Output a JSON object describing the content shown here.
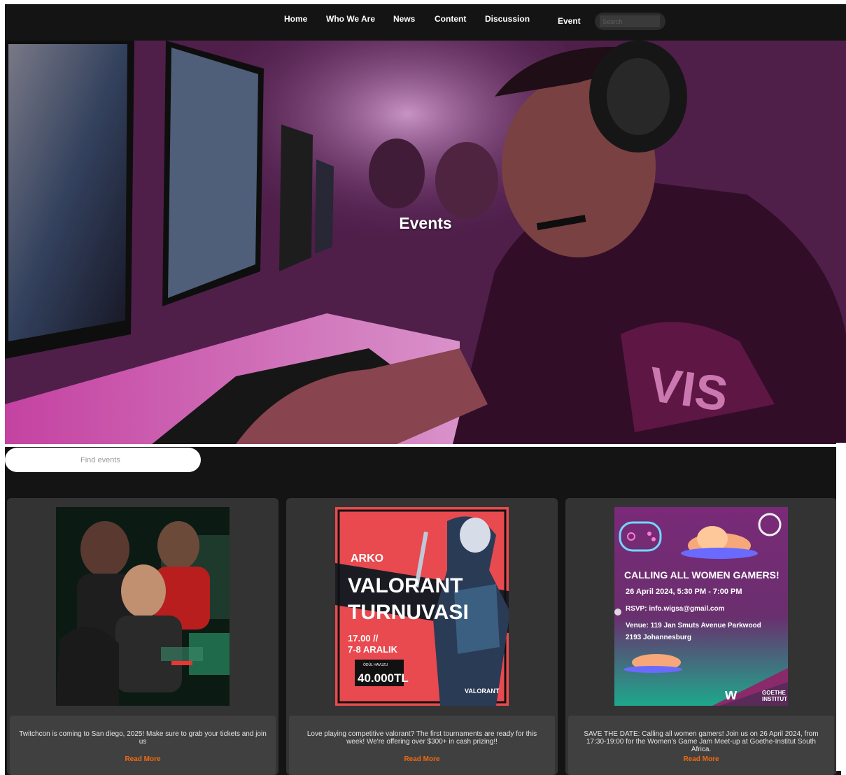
{
  "nav": {
    "items": [
      "Home",
      "Who We Are",
      "News",
      "Content",
      "Discussion",
      "Event"
    ],
    "search_placeholder": "Search"
  },
  "hero": {
    "title": "Events"
  },
  "events": {
    "find_placeholder": "Find events",
    "cards": [
      {
        "description": "Twitchcon is coming to San diego, 2025! Make sure to grab your tickets and join us",
        "link": "Read More"
      },
      {
        "description": "Love playing competitive valorant? The first tournaments are ready for this week! We're offering over $300+ in cash prizing!!",
        "link": "Read More",
        "poster": {
          "brand": "ARKO",
          "title_line1": "VALORANT",
          "title_line2": "TURNUVASI",
          "time": "17.00 //",
          "date": "7-8 ARALIK",
          "prize_label": "ÖDÜL HAVUZU",
          "prize": "40.000TL",
          "logo": "VALORANT"
        }
      },
      {
        "description": "SAVE THE DATE: Calling all women gamers! Join us on 26 April 2024, from 17:30-19:00 for the Women's Game Jam Meet-up at Goethe-Institut South Africa.",
        "link": "Read More",
        "poster": {
          "headline": "CALLING ALL WOMEN GAMERS!",
          "date": "26 April 2024, 5:30 PM - 7:00 PM",
          "rsvp": "RSVP: info.wigsa@gmail.com",
          "venue_line1": "Venue: 119 Jan Smuts Avenue Parkwood",
          "venue_line2": "2193 Johannesburg",
          "brand_line1": "GOETHE",
          "brand_line2": "INSTITUT"
        }
      }
    ]
  }
}
